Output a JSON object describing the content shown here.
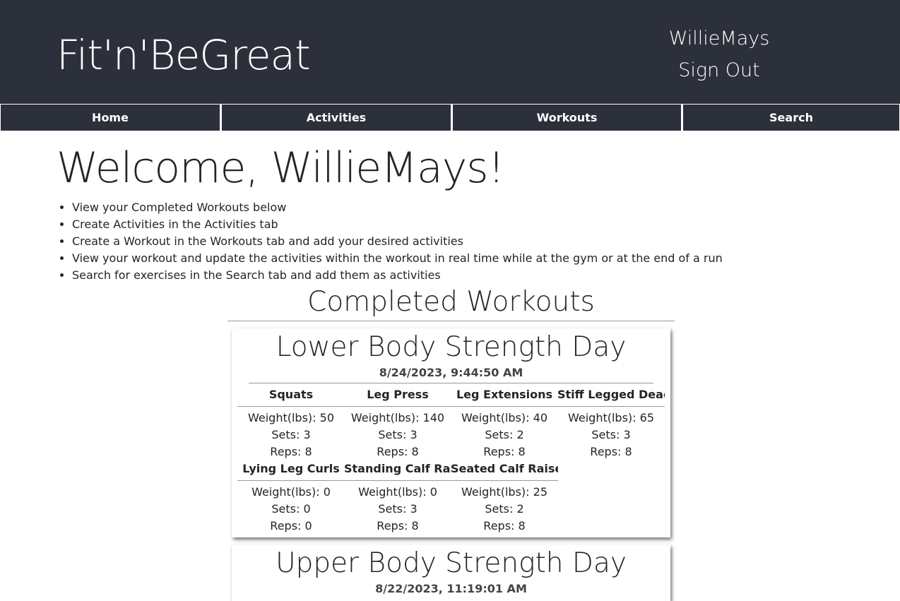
{
  "header": {
    "brand": "Fit'n'BeGreat",
    "username": "WillieMays",
    "signout_label": "Sign Out"
  },
  "nav": {
    "items": [
      {
        "label": "Home"
      },
      {
        "label": "Activities"
      },
      {
        "label": "Workouts"
      },
      {
        "label": "Search"
      }
    ]
  },
  "main": {
    "welcome": "Welcome, WillieMays!",
    "tips": [
      "View your Completed Workouts below",
      "Create Activities in the Activities tab",
      "Create a Workout in the Workouts tab and add your desired activities",
      "View your workout and update the activities within the workout in real time while at the gym or at the end of a run",
      "Search for exercises in the Search tab and add them as activities"
    ],
    "section_title": "Completed Workouts"
  },
  "workouts": [
    {
      "title": "Lower Body Strength Day",
      "date": "8/24/2023, 9:44:50 AM",
      "activities": [
        {
          "name": "Squats",
          "weight": "Weight(lbs): 50",
          "sets": "Sets: 3",
          "reps": "Reps: 8"
        },
        {
          "name": "Leg Press",
          "weight": "Weight(lbs): 140",
          "sets": "Sets: 3",
          "reps": "Reps: 8"
        },
        {
          "name": "Leg Extensions",
          "weight": "Weight(lbs): 40",
          "sets": "Sets: 2",
          "reps": "Reps: 8"
        },
        {
          "name": "Stiff Legged Dead",
          "weight": "Weight(lbs): 65",
          "sets": "Sets: 3",
          "reps": "Reps: 8"
        },
        {
          "name": "Lying Leg Curls",
          "weight": "Weight(lbs): 0",
          "sets": "Sets: 0",
          "reps": "Reps: 0"
        },
        {
          "name": "Standing Calf Rais",
          "weight": "Weight(lbs): 0",
          "sets": "Sets: 3",
          "reps": "Reps: 8"
        },
        {
          "name": "Seated Calf Raise",
          "weight": "Weight(lbs): 25",
          "sets": "Sets: 2",
          "reps": "Reps: 8"
        }
      ]
    },
    {
      "title": "Upper Body Strength Day",
      "date": "8/22/2023, 11:19:01 AM",
      "activities": []
    }
  ]
}
